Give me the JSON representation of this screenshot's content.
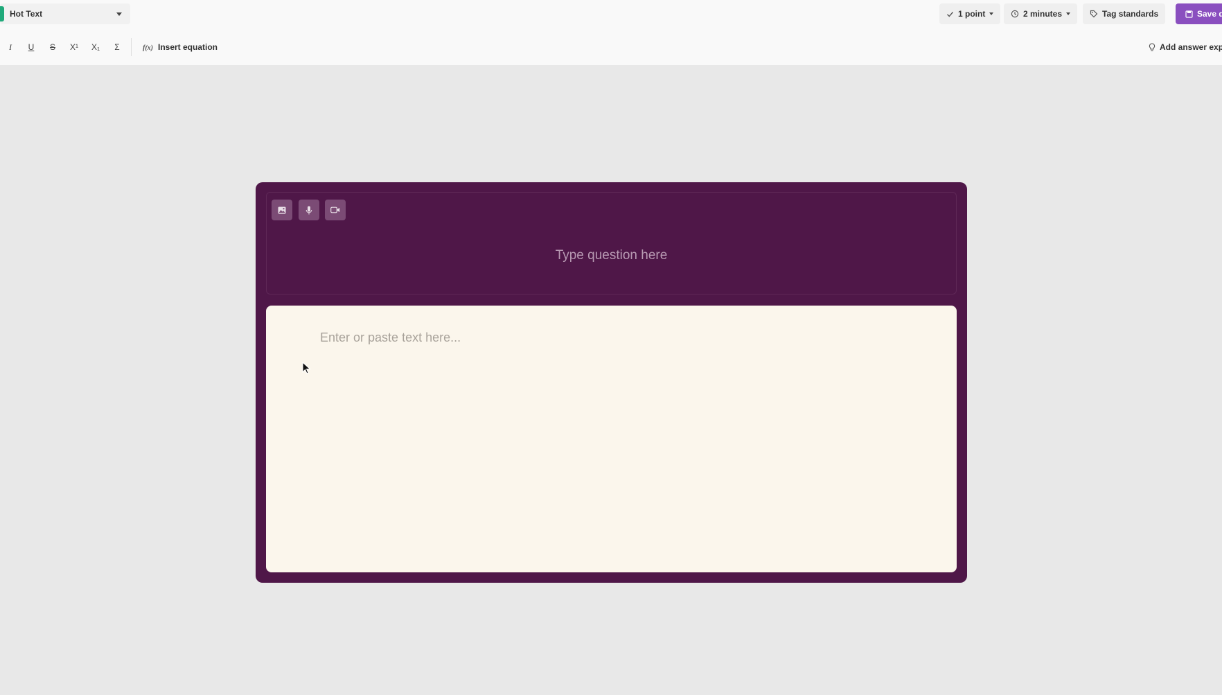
{
  "header": {
    "question_type": "Hot Text",
    "points": "1 point",
    "time": "2 minutes",
    "tag_standards": "Tag standards",
    "save": "Save q"
  },
  "toolbar": {
    "italic": "I",
    "underline": "U",
    "strike": "S",
    "superscript": "X¹",
    "subscript": "X₁",
    "sigma": "Σ",
    "insert_equation": "Insert equation",
    "add_answer_explanation": "Add answer exp"
  },
  "editor": {
    "question_placeholder": "Type question here",
    "text_placeholder": "Enter or paste text here..."
  },
  "colors": {
    "card": "#4f1748",
    "text_area": "#fbf6ec",
    "save_button": "#8a4fbf",
    "type_badge": "#1fa97a"
  }
}
